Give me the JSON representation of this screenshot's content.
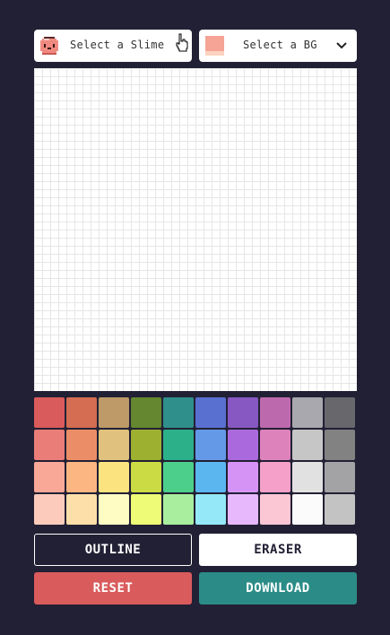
{
  "slime_select": {
    "label": "Select a Slime",
    "icon": "slime-icon"
  },
  "bg_select": {
    "label": "Select a BG",
    "icon": "chevron-down-icon"
  },
  "palette": {
    "colors": [
      "#d95b5b",
      "#d46d51",
      "#bd9a68",
      "#64872f",
      "#2f8f8a",
      "#5970d1",
      "#8757c2",
      "#bd69ad",
      "#a9a8ae",
      "#68676c",
      "#ea7d78",
      "#eb8e68",
      "#e0c17d",
      "#9db030",
      "#2bb089",
      "#6499e8",
      "#aa6ade",
      "#de82bc",
      "#c6c6c6",
      "#828282",
      "#f9a898",
      "#fbb682",
      "#fbe47f",
      "#cbdb44",
      "#4ccf8a",
      "#5bb6f0",
      "#d693f6",
      "#f5a0c8",
      "#e1e1e1",
      "#a3a3a6",
      "#fdcbbc",
      "#fde0a9",
      "#fefbc3",
      "#eefb77",
      "#a9ee9f",
      "#95e8f7",
      "#e7b8fb",
      "#fcc7d5",
      "#fbfbfb",
      "#c3c3c3"
    ]
  },
  "buttons": {
    "outline": "OUTLINE",
    "eraser": "ERASER",
    "reset": "RESET",
    "download": "DOWNLOAD"
  },
  "colors": {
    "background": "#222034",
    "reset": "#d95b5b",
    "download": "#2b8c87"
  }
}
